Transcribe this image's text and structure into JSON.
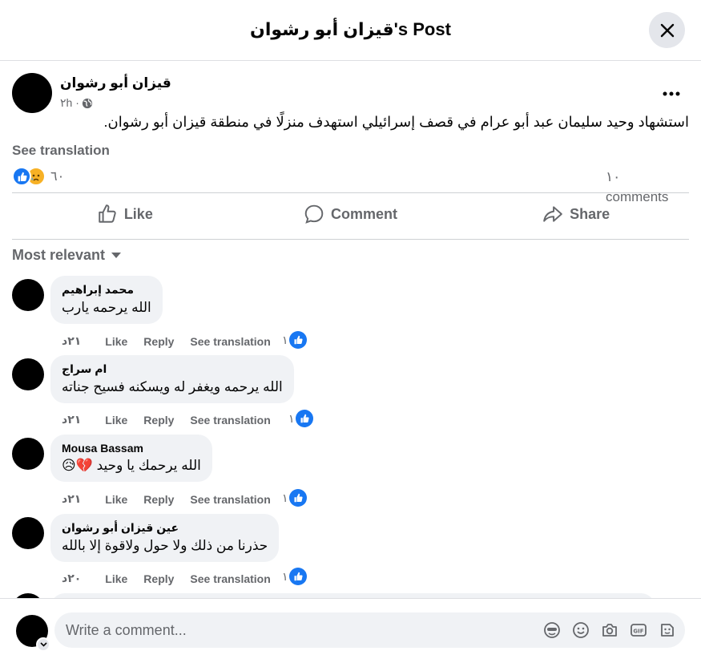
{
  "header": {
    "title": "قيزان أبو رشوان's Post",
    "close_icon": "close-icon"
  },
  "post": {
    "author": "قيزان أبو رشوان",
    "time": "٢h ·",
    "privacy_icon": "globe-icon",
    "text": "استشهاد وحيد سليمان عبد أبو عرام في قصف إسرائيلي استهدف منزلًا في منطقة قيزان أبو رشوان.",
    "see_translation": "See translation",
    "reactions": {
      "icons": [
        "like-icon",
        "sad-icon"
      ],
      "count": "٦٠",
      "like_color": "#1877f2",
      "sad_color": "#f7b125"
    },
    "comments_count": "١٠ comments"
  },
  "actions": {
    "like": "Like",
    "comment": "Comment",
    "share": "Share"
  },
  "comments_section": {
    "sort_label": "Most relevant",
    "comments": [
      {
        "name": "محمد إبراهيم",
        "text": "الله يرحمه يارب",
        "time": "٢١د",
        "like": "Like",
        "reply": "Reply",
        "see_translation": "See translation",
        "like_count": "١"
      },
      {
        "name": "ام سراج",
        "text": "الله يرحمه ويغفر له ويسكنه فسيح جناته",
        "time": "٢١د",
        "like": "Like",
        "reply": "Reply",
        "see_translation": "See translation",
        "like_count": "١"
      },
      {
        "name": "Mousa Bassam",
        "text": "الله يرحمك يا وحيد 💔😥",
        "time": "٢١د",
        "like": "Like",
        "reply": "Reply",
        "see_translation": "See translation",
        "like_count": "١"
      },
      {
        "name": "عين قيزان أبو رشوان",
        "text": "حذرنا من ذلك ولا حول ولاقوة إلا بالله",
        "time": "٢٠د",
        "like": "Like",
        "reply": "Reply",
        "see_translation": "See translation",
        "like_count": "١"
      }
    ]
  },
  "composer": {
    "placeholder": "Write a comment...",
    "tools": [
      "avatar-sticker-icon",
      "emoji-icon",
      "camera-icon",
      "gif-icon",
      "sticker-icon"
    ]
  }
}
